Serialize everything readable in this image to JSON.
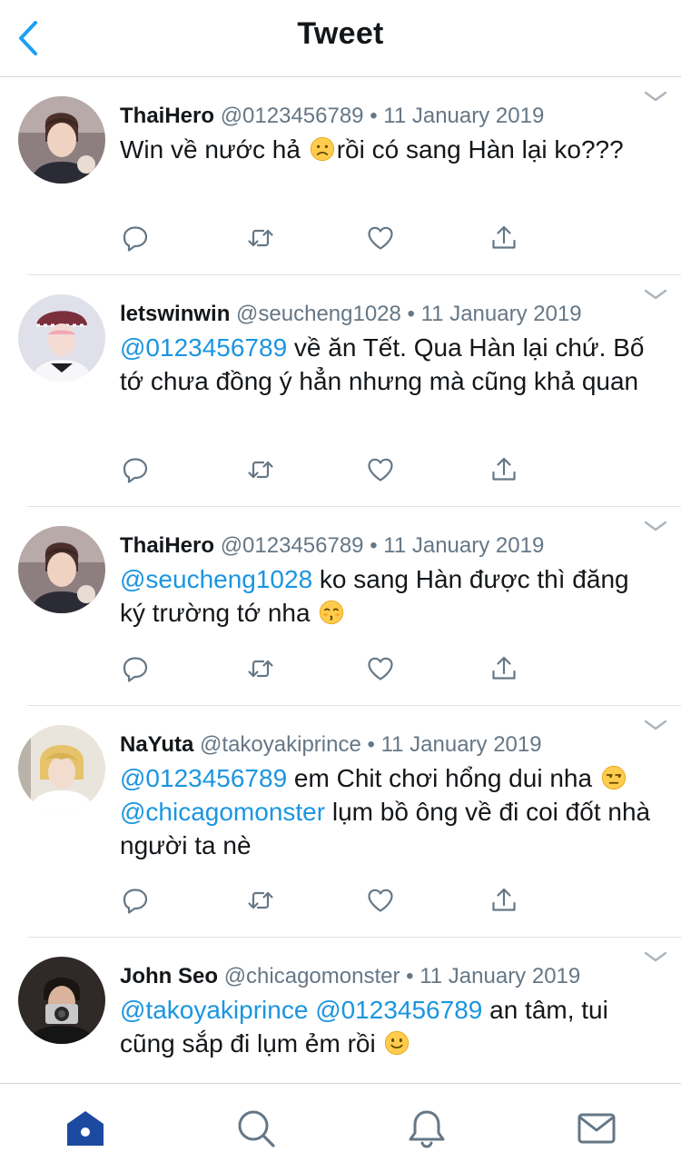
{
  "header": {
    "title": "Tweet"
  },
  "colors": {
    "accent": "#1da1f2",
    "mention": "#1b95e0",
    "text": "#14171a",
    "secondary": "#657786",
    "divider": "#dfe3e7",
    "tab_active": "#1c4aa0"
  },
  "icons": {
    "back": "chevron-left-icon",
    "menu": "chevron-down-icon",
    "reply": "reply-icon",
    "retweet": "retweet-icon",
    "like": "heart-icon",
    "share": "share-icon",
    "tabs": [
      "home-icon",
      "search-icon",
      "notifications-icon",
      "messages-icon"
    ]
  },
  "tweets": [
    {
      "name": "ThaiHero",
      "handle": "@0123456789",
      "dot": "•",
      "date": "11 January 2019",
      "t1": "Win về nước hả ",
      "t2": "rồi có sang Hàn lại ko???"
    },
    {
      "name": "letswinwin",
      "handle": "@seucheng1028",
      "dot": "•",
      "date": "11 January 2019",
      "m1": "@0123456789",
      "t1": " về ăn Tết. Qua Hàn lại chứ. Bố tớ chưa đồng ý hẳn nhưng mà cũng khả quan"
    },
    {
      "name": "ThaiHero",
      "handle": "@0123456789",
      "dot": "•",
      "date": "11 January 2019",
      "m1": "@seucheng1028",
      "t1": " ko sang Hàn được thì đăng ký trường tớ nha "
    },
    {
      "name": "NaYuta",
      "handle": "@takoyakiprince",
      "dot": "•",
      "date": "11 January 2019",
      "m1": "@0123456789",
      "t1": " em Chit chơi hổng dui nha ",
      "m2": "@chicagomonster",
      "t2": " lụm bồ ông về đi coi đốt nhà người ta nè"
    },
    {
      "name": "John Seo",
      "handle": "@chicagomonster",
      "dot": "•",
      "date": "11 January 2019",
      "m1": "@takoyakiprince",
      "t0": " ",
      "m2": "@0123456789",
      "t1": " an tâm, tui cũng sắp đi lụm ẻm rồi "
    }
  ]
}
